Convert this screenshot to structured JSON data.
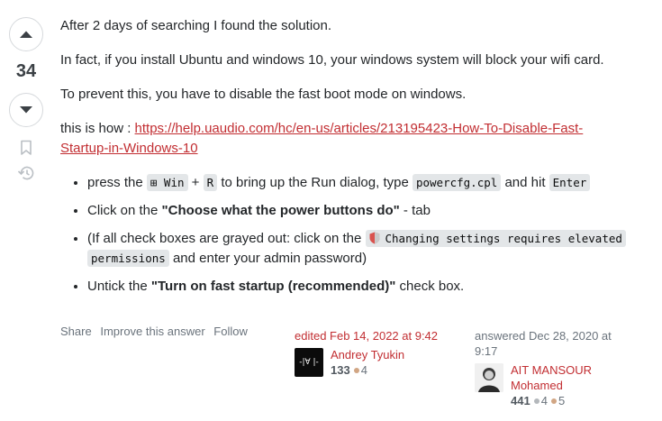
{
  "votes": {
    "count": "34"
  },
  "answer": {
    "p1": "After 2 days of searching I found the solution.",
    "p2": "In fact, if you install Ubuntu and windows 10, your windows system will block your wifi card.",
    "p3": "To prevent this, you have to disable the fast boot mode on windows.",
    "p4_prefix": "this is how : ",
    "link_line1": "https://help.uaudio.com/hc/en-us/articles/213195423-How-To-Disable-Fast-",
    "link_line2": "Startup-in-Windows-10",
    "bullets": {
      "b1_press": "press the ",
      "b1_win_key": "⊞ Win",
      "b1_plus": " + ",
      "b1_r_key": "R",
      "b1_mid": " to bring up the Run dialog, type ",
      "b1_code": "powercfg.cpl",
      "b1_hit": " and hit ",
      "b1_enter": "Enter",
      "b2_pre": "Click on the ",
      "b2_bold": "\"Choose what the power buttons do\"",
      "b2_post": " - tab",
      "b3_pre": "(If all check boxes are grayed out: click on the ",
      "b3_code1": "Changing settings requires elevated",
      "b3_code2": "permissions",
      "b3_post": " and enter your admin password)",
      "b4_pre": "Untick the ",
      "b4_bold": "\"Turn on fast startup (recommended)\"",
      "b4_post": " check box."
    }
  },
  "post_menu": {
    "share": "Share",
    "improve": "Improve this answer",
    "follow": "Follow"
  },
  "editor": {
    "action": "edited Feb 14, 2022 at 9:42",
    "name": "Andrey Tyukin",
    "rep": "133",
    "bronze": "4",
    "avatar_text": "-|∀ |-"
  },
  "author": {
    "action_line1": "answered Dec 28, 2020 at",
    "action_line2": "9:17",
    "name_line1": "AIT MANSOUR",
    "name_line2": "Mohamed",
    "rep": "441",
    "silver": "4",
    "bronze": "5"
  },
  "colors": {
    "link": "#c22e32",
    "silver": "#b4b8bc",
    "bronze": "#d1a684"
  }
}
